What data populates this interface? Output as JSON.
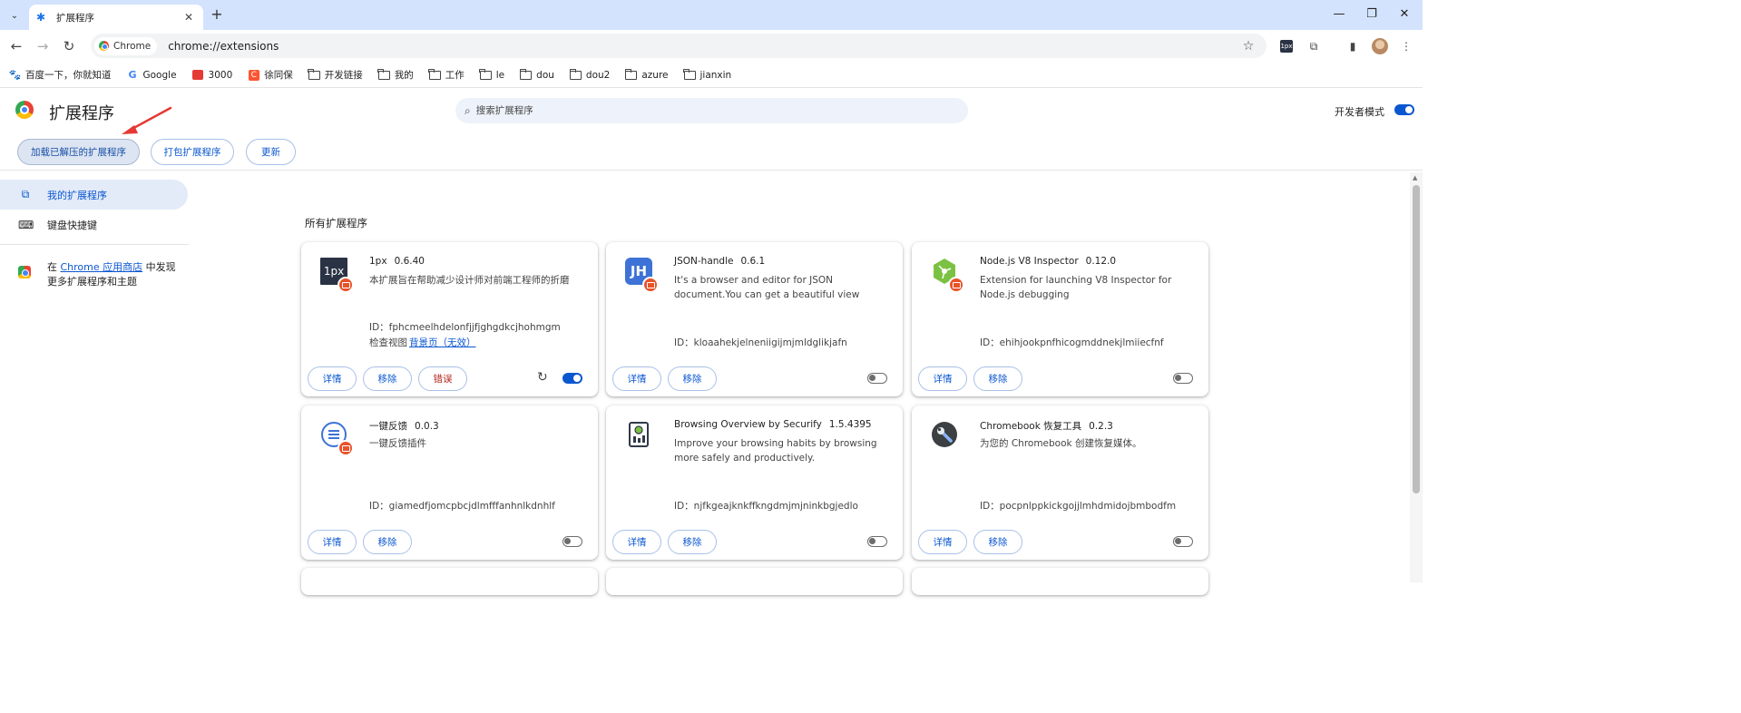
{
  "browser": {
    "tab_title": "扩展程序",
    "chip_label": "Chrome",
    "url": "chrome://extensions",
    "ext_mini_label": "1px"
  },
  "bookmarks": [
    {
      "label": "百度一下，你就知道",
      "icon": "baidu-icon"
    },
    {
      "label": "Google",
      "icon": "google-icon"
    },
    {
      "label": "3000",
      "icon": "red-app-icon"
    },
    {
      "label": "徐同保",
      "icon": "csdn-icon"
    },
    {
      "label": "开发链接",
      "icon": "folder-icon"
    },
    {
      "label": "我的",
      "icon": "folder-icon"
    },
    {
      "label": "工作",
      "icon": "folder-icon"
    },
    {
      "label": "le",
      "icon": "folder-icon"
    },
    {
      "label": "dou",
      "icon": "folder-icon"
    },
    {
      "label": "dou2",
      "icon": "folder-icon"
    },
    {
      "label": "azure",
      "icon": "folder-icon"
    },
    {
      "label": "jianxin",
      "icon": "folder-icon"
    }
  ],
  "header": {
    "title": "扩展程序",
    "search_placeholder": "搜索扩展程序",
    "dev_mode_label": "开发者模式",
    "dev_mode_on": true,
    "load_unpacked": "加载已解压的扩展程序",
    "pack_extension": "打包扩展程序",
    "update": "更新"
  },
  "sidebar": {
    "my_extensions": "我的扩展程序",
    "shortcuts": "键盘快捷键",
    "store_prefix": "在",
    "store_link": "Chrome 应用商店",
    "store_suffix": "中发现",
    "store_line2": "更多扩展程序和主题"
  },
  "main": {
    "section_title": "所有扩展程序",
    "details_label": "详情",
    "remove_label": "移除",
    "errors_label": "错误",
    "inspect_prefix": "检查视图",
    "inspect_link": "背景页（无效）",
    "extensions": [
      {
        "name": "1px",
        "version": "0.6.40",
        "description": "本扩展旨在帮助减少设计师对前端工程师的折磨",
        "id": "ID：fphcmeelhdelonfjjfjghgdkcjhohmgm",
        "enabled": true,
        "icon": "1px-logo-icon"
      },
      {
        "name": "JSON-handle",
        "version": "0.6.1",
        "description": "It's a browser and editor for JSON document.You can get a beautiful view",
        "id": "ID：kloaahekjelneniigijmjmldglikjafn",
        "enabled": false,
        "icon": "jh-logo-icon"
      },
      {
        "name": "Node.js V8 Inspector",
        "version": "0.12.0",
        "description": "Extension for launching V8 Inspector for Node.js debugging",
        "id": "ID：ehihjookpnfhicogmddnekjlmiiecfnf",
        "enabled": false,
        "icon": "nodejs-hexagon-icon"
      },
      {
        "name": "一键反馈",
        "version": "0.0.3",
        "description": "一键反馈插件",
        "id": "ID：giamedfjomcpbcjdlmfffanhnlkdnhlf",
        "enabled": false,
        "icon": "feedback-circle-icon"
      },
      {
        "name": "Browsing Overview by Securify",
        "version": "1.5.4395",
        "description": "Improve your browsing habits by browsing more safely and productively.",
        "id": "ID：njfkgeajknkffkngdmjmjninkbgjedlo",
        "enabled": false,
        "icon": "securify-document-icon"
      },
      {
        "name": "Chromebook 恢复工具",
        "version": "0.2.3",
        "description": "为您的 Chromebook 创建恢复媒体。",
        "id": "ID：pocpnlppkickgojjlmhdmidojbmbodfm",
        "enabled": false,
        "icon": "wrench-circle-icon"
      }
    ]
  },
  "colors": {
    "accent": "#0b57d0",
    "tabstrip": "#d3e3fd",
    "error": "#b3261e",
    "badge": "#e8532a",
    "annotation_arrow": "#e53935"
  }
}
